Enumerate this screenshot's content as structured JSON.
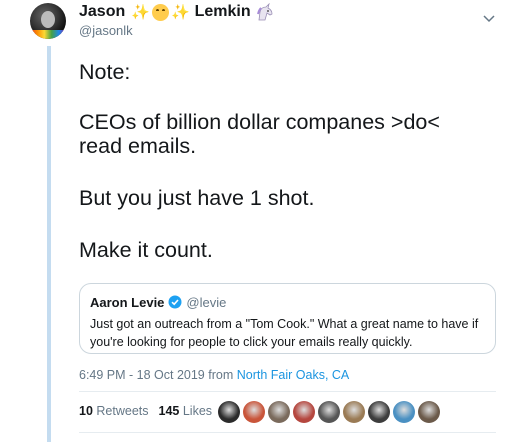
{
  "author": {
    "first_name": "Jason",
    "last_name": "Lemkin",
    "handle": "@jasonlk",
    "name_icons": [
      "sparkles-icon",
      "smiling-face-icon",
      "sparkles-icon",
      "unicorn-icon"
    ]
  },
  "tweet": {
    "lines": [
      "Note:",
      "CEOs of billion dollar companes >do<",
      "read emails.",
      "But you just have 1 shot.",
      "Make it count."
    ]
  },
  "quoted_tweet": {
    "name": "Aaron Levie",
    "handle": "@levie",
    "verified": true,
    "text": "Just got an outreach from a \"Tom Cook.\" What a great name to have if you're looking for people to click your emails really quickly."
  },
  "meta": {
    "time_date": "6:49 PM - 18 Oct 2019 from",
    "location": "North Fair Oaks, CA"
  },
  "stats": {
    "retweets_count": "10",
    "retweets_label": "Retweets",
    "likes_count": "145",
    "likes_label": "Likes"
  },
  "likers": [
    {
      "color": "#2b2b2b"
    },
    {
      "color": "#c9553a"
    },
    {
      "color": "#7a6a5c"
    },
    {
      "color": "#b5473f"
    },
    {
      "color": "#555555"
    },
    {
      "color": "#9a7b55"
    },
    {
      "color": "#3d3d3d"
    },
    {
      "color": "#4a90c2"
    },
    {
      "color": "#6b5a4a"
    }
  ],
  "colors": {
    "accent": "#1b95e0",
    "text": "#14171a",
    "muted": "#657786",
    "thread_line": "#c4dcf0"
  }
}
